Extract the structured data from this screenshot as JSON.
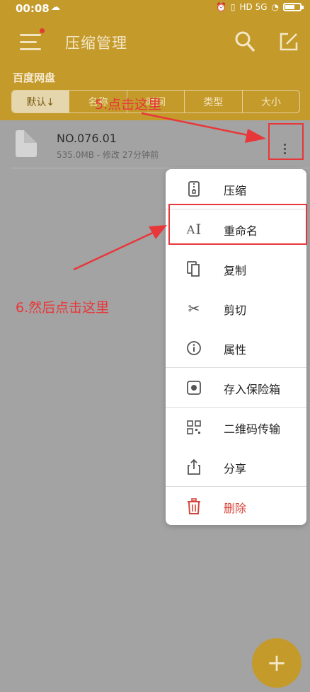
{
  "status_bar": {
    "time": "00:08",
    "network_badges": "HD 5G"
  },
  "app_bar": {
    "title": "压缩管理"
  },
  "breadcrumb": "百度网盘",
  "sort_tabs": [
    {
      "label": "默认↓",
      "active": true
    },
    {
      "label": "名称",
      "active": false
    },
    {
      "label": "时间",
      "active": false
    },
    {
      "label": "类型",
      "active": false
    },
    {
      "label": "大小",
      "active": false
    }
  ],
  "file": {
    "name": "NO.076.01",
    "meta": "535.0MB - 修改 27分钟前"
  },
  "context_menu": [
    {
      "label": "压缩",
      "icon": "zip-icon"
    },
    {
      "label": "重命名",
      "icon": "rename-icon"
    },
    {
      "label": "复制",
      "icon": "copy-icon"
    },
    {
      "label": "剪切",
      "icon": "scissors-icon"
    },
    {
      "label": "属性",
      "icon": "info-icon"
    },
    {
      "label": "存入保险箱",
      "icon": "safe-icon"
    },
    {
      "label": "二维码传输",
      "icon": "qrcode-icon"
    },
    {
      "label": "分享",
      "icon": "share-icon"
    },
    {
      "label": "删除",
      "icon": "trash-icon"
    }
  ],
  "annotations": {
    "step5": "5.点击这里",
    "step6": "6.然后点击这里"
  },
  "fab_label": "+",
  "colors": {
    "brand": "#c49a2a",
    "annotation": "#e8373a",
    "danger": "#d6453b"
  }
}
